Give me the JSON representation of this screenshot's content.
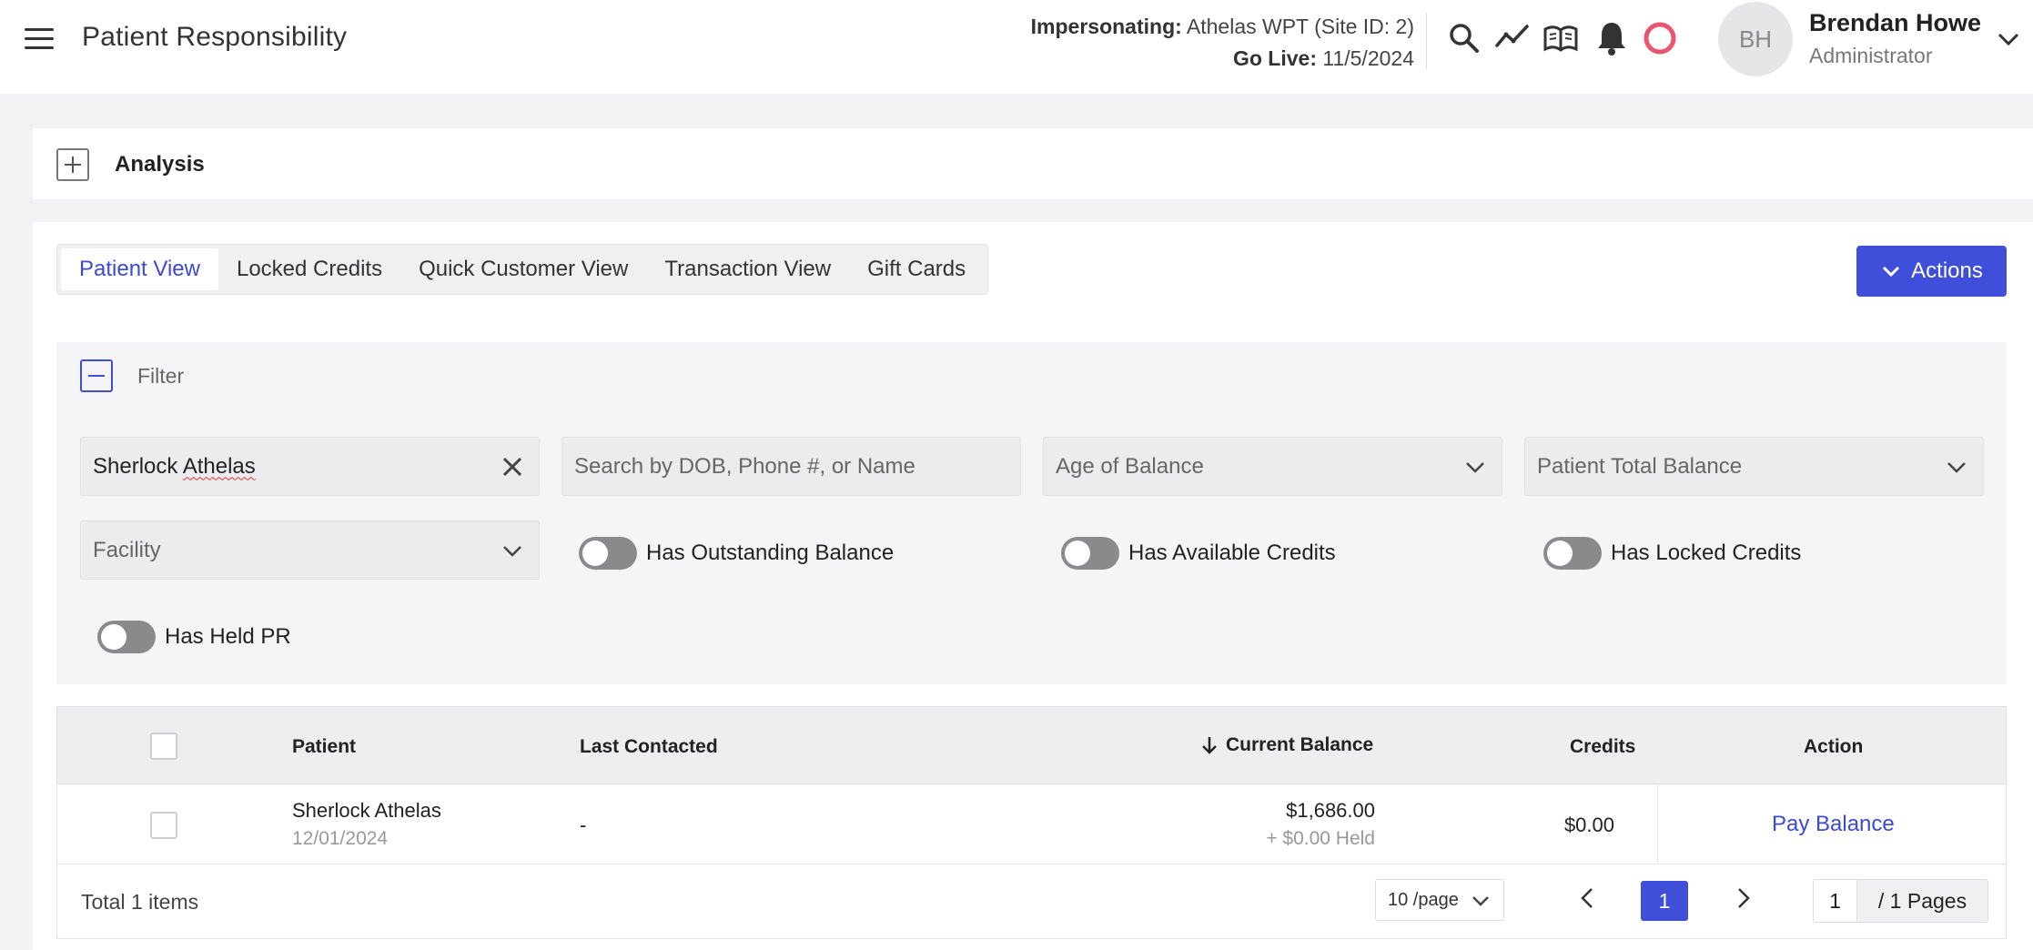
{
  "header": {
    "title": "Patient Responsibility",
    "impersonating_label": "Impersonating:",
    "impersonating_value": "Athelas WPT (Site ID: 2)",
    "golive_label": "Go Live:",
    "golive_value": "11/5/2024",
    "icons": [
      "search-icon",
      "trend-icon",
      "book-icon",
      "bell-icon",
      "status-ring-icon"
    ],
    "user": {
      "initials": "BH",
      "name": "Brendan Howe",
      "role": "Administrator"
    }
  },
  "analysis": {
    "label": "Analysis"
  },
  "tabs": [
    {
      "label": "Patient View",
      "active": true
    },
    {
      "label": "Locked Credits",
      "active": false
    },
    {
      "label": "Quick Customer View",
      "active": false
    },
    {
      "label": "Transaction View",
      "active": false
    },
    {
      "label": "Gift Cards",
      "active": false
    }
  ],
  "actions": {
    "label": "Actions"
  },
  "filter": {
    "label": "Filter",
    "patient_value_first": "Sherlock",
    "patient_value_last": "Athelas",
    "search_placeholder": "Search by DOB, Phone #, or Name",
    "age_of_balance": "Age of Balance",
    "patient_total_balance": "Patient Total Balance",
    "facility": "Facility",
    "toggles": [
      {
        "label": "Has Outstanding Balance",
        "on": false
      },
      {
        "label": "Has Available Credits",
        "on": false
      },
      {
        "label": "Has Locked Credits",
        "on": false
      },
      {
        "label": "Has Held PR",
        "on": false
      }
    ]
  },
  "table": {
    "columns": {
      "patient": "Patient",
      "last_contacted": "Last Contacted",
      "current_balance": "Current Balance",
      "credits": "Credits",
      "action": "Action"
    },
    "rows": [
      {
        "patient": "Sherlock Athelas",
        "dob": "12/01/2024",
        "last_contacted": "-",
        "current_balance": "$1,686.00",
        "held": "+ $0.00 Held",
        "credits": "$0.00",
        "action": "Pay Balance"
      }
    ]
  },
  "pagination": {
    "total": "Total 1 items",
    "page_size": "10 /page",
    "current_page": "1",
    "jump_value": "1",
    "pages_suffix": "/ 1 Pages"
  },
  "colors": {
    "accent": "#3f4fd9",
    "status_ring": "#e8576f"
  }
}
